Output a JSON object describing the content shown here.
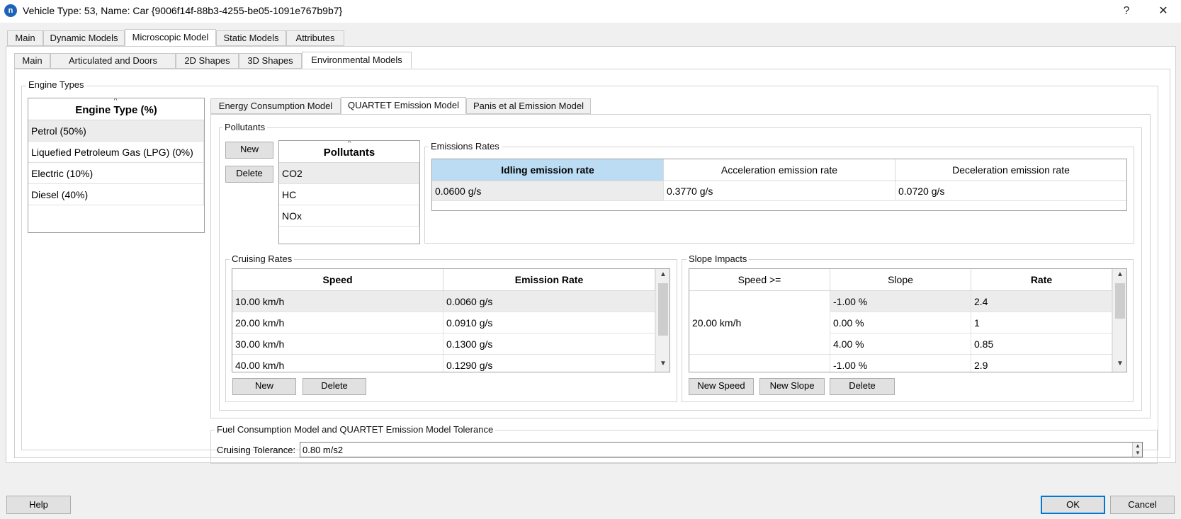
{
  "window": {
    "title": "Vehicle Type: 53, Name: Car  {9006f14f-88b3-4255-be05-1091e767b9b7}",
    "help_glyph": "?",
    "close_glyph": "✕",
    "app_icon_glyph": "n"
  },
  "tabs_top": [
    "Main",
    "Dynamic Models",
    "Microscopic Model",
    "Static Models",
    "Attributes"
  ],
  "tabs_second": [
    "Main",
    "Articulated and Doors",
    "2D Shapes",
    "3D Shapes",
    "Environmental Models"
  ],
  "engine_types": {
    "group_label": "Engine Types",
    "header": "Engine Type (%)",
    "items": [
      "Petrol (50%)",
      "Liquefied Petroleum Gas (LPG) (0%)",
      "Electric (10%)",
      "Diesel (40%)"
    ]
  },
  "model_tabs": [
    "Energy Consumption Model",
    "QUARTET Emission Model",
    "Panis et al Emission Model"
  ],
  "pollutants": {
    "group_label": "Pollutants",
    "new_label": "New",
    "delete_label": "Delete",
    "header": "Pollutants",
    "items": [
      "CO2",
      "HC",
      "NOx"
    ]
  },
  "emissions_rates": {
    "group_label": "Emissions Rates",
    "headers": [
      "Idling emission rate",
      "Acceleration emission rate",
      "Deceleration emission rate"
    ],
    "values": [
      "0.0600 g/s",
      "0.3770 g/s",
      "0.0720 g/s"
    ]
  },
  "cruising_rates": {
    "group_label": "Cruising Rates",
    "headers": [
      "Speed",
      "Emission Rate"
    ],
    "rows": [
      [
        "10.00 km/h",
        "0.0060 g/s"
      ],
      [
        "20.00 km/h",
        "0.0910 g/s"
      ],
      [
        "30.00 km/h",
        "0.1300 g/s"
      ],
      [
        "40.00 km/h",
        "0.1290 g/s"
      ]
    ],
    "new_label": "New",
    "delete_label": "Delete"
  },
  "slope_impacts": {
    "group_label": "Slope Impacts",
    "headers": [
      "Speed >=",
      "Slope",
      "Rate"
    ],
    "speed_group": "20.00 km/h",
    "rows": [
      [
        "-1.00 %",
        "2.4"
      ],
      [
        "0.00 %",
        "1"
      ],
      [
        "4.00 %",
        "0.85"
      ],
      [
        "-1.00 %",
        "2.9"
      ]
    ],
    "new_speed_label": "New Speed",
    "new_slope_label": "New Slope",
    "delete_label": "Delete"
  },
  "tolerance": {
    "group_label": "Fuel Consumption Model and QUARTET Emission Model Tolerance",
    "field_label": "Cruising Tolerance:",
    "value": "0.80 m/s2"
  },
  "footer": {
    "help_label": "Help",
    "ok_label": "OK",
    "cancel_label": "Cancel"
  },
  "colors": {
    "header_selected": "#bcdcf4",
    "row_selected": "#ececec",
    "accent": "#0078d7"
  }
}
